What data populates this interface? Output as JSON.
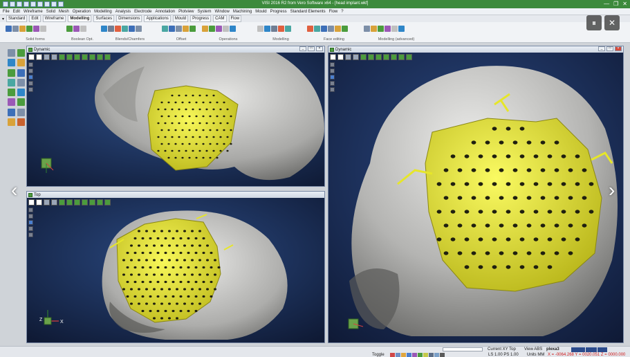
{
  "window": {
    "title": "VISI 2016 R2 from Vero Software x64 - [head implant.wkf]",
    "min_label": "—",
    "restore_label": "❐",
    "close_label": "✕"
  },
  "menu": [
    "File",
    "Edit",
    "Wireframe",
    "Solid",
    "Mesh",
    "Operation",
    "Modelling",
    "Analysis",
    "Electrode",
    "Annotation",
    "Plotview",
    "System",
    "Window",
    "Machining",
    "Mould",
    "Progress",
    "Standard Elements",
    "Flow",
    "?"
  ],
  "tabs": [
    {
      "label": "Standard",
      "active": false
    },
    {
      "label": "Edit",
      "active": false
    },
    {
      "label": "Wireframe",
      "active": false
    },
    {
      "label": "Modelling",
      "active": true
    },
    {
      "label": "Surfaces",
      "active": false
    },
    {
      "label": "Dimensions",
      "active": false
    },
    {
      "label": "Applications",
      "active": false
    },
    {
      "label": "Mould",
      "active": false
    },
    {
      "label": "Progress",
      "active": false
    },
    {
      "label": "CAM",
      "active": false
    },
    {
      "label": "Flow",
      "active": false
    }
  ],
  "ribbon_groups": [
    {
      "label": "Solid forms",
      "icon_count": 6
    },
    {
      "label": "Boolean Opt.",
      "icon_count": 3
    },
    {
      "label": "Blends/Chamfers",
      "icon_count": 6
    },
    {
      "label": "Offset",
      "icon_count": 5
    },
    {
      "label": "Operations",
      "icon_count": 5
    },
    {
      "label": "Modelling",
      "icon_count": 5
    },
    {
      "label": "Face editing",
      "icon_count": 6
    },
    {
      "label": "Modelling (advanced)",
      "icon_count": 6
    }
  ],
  "overlay": {
    "pause": "⏸",
    "close": "✕"
  },
  "nav": {
    "left": "‹",
    "right": "›"
  },
  "viewports": {
    "top_left": {
      "title": "Dynamic"
    },
    "bottom_left": {
      "title": "Top"
    },
    "right": {
      "title": "Dynamic"
    }
  },
  "axis_labels": {
    "x": "X",
    "y": "Y",
    "z": "Z"
  },
  "status": {
    "toggle": "Toggle",
    "current_view": "Current XY Top",
    "view": "View ABS",
    "layer": "plexa3",
    "ls": "LS 1.00 PS 1.00",
    "units": "Units MM",
    "coords": "X = -0064.268 Y = 0020.051 Z = 0000.000"
  },
  "colors": {
    "implant": "#e6e62a",
    "skull": "#c9c9c7",
    "background": "#1a2a4e",
    "titlebar": "#3c8a3c"
  }
}
